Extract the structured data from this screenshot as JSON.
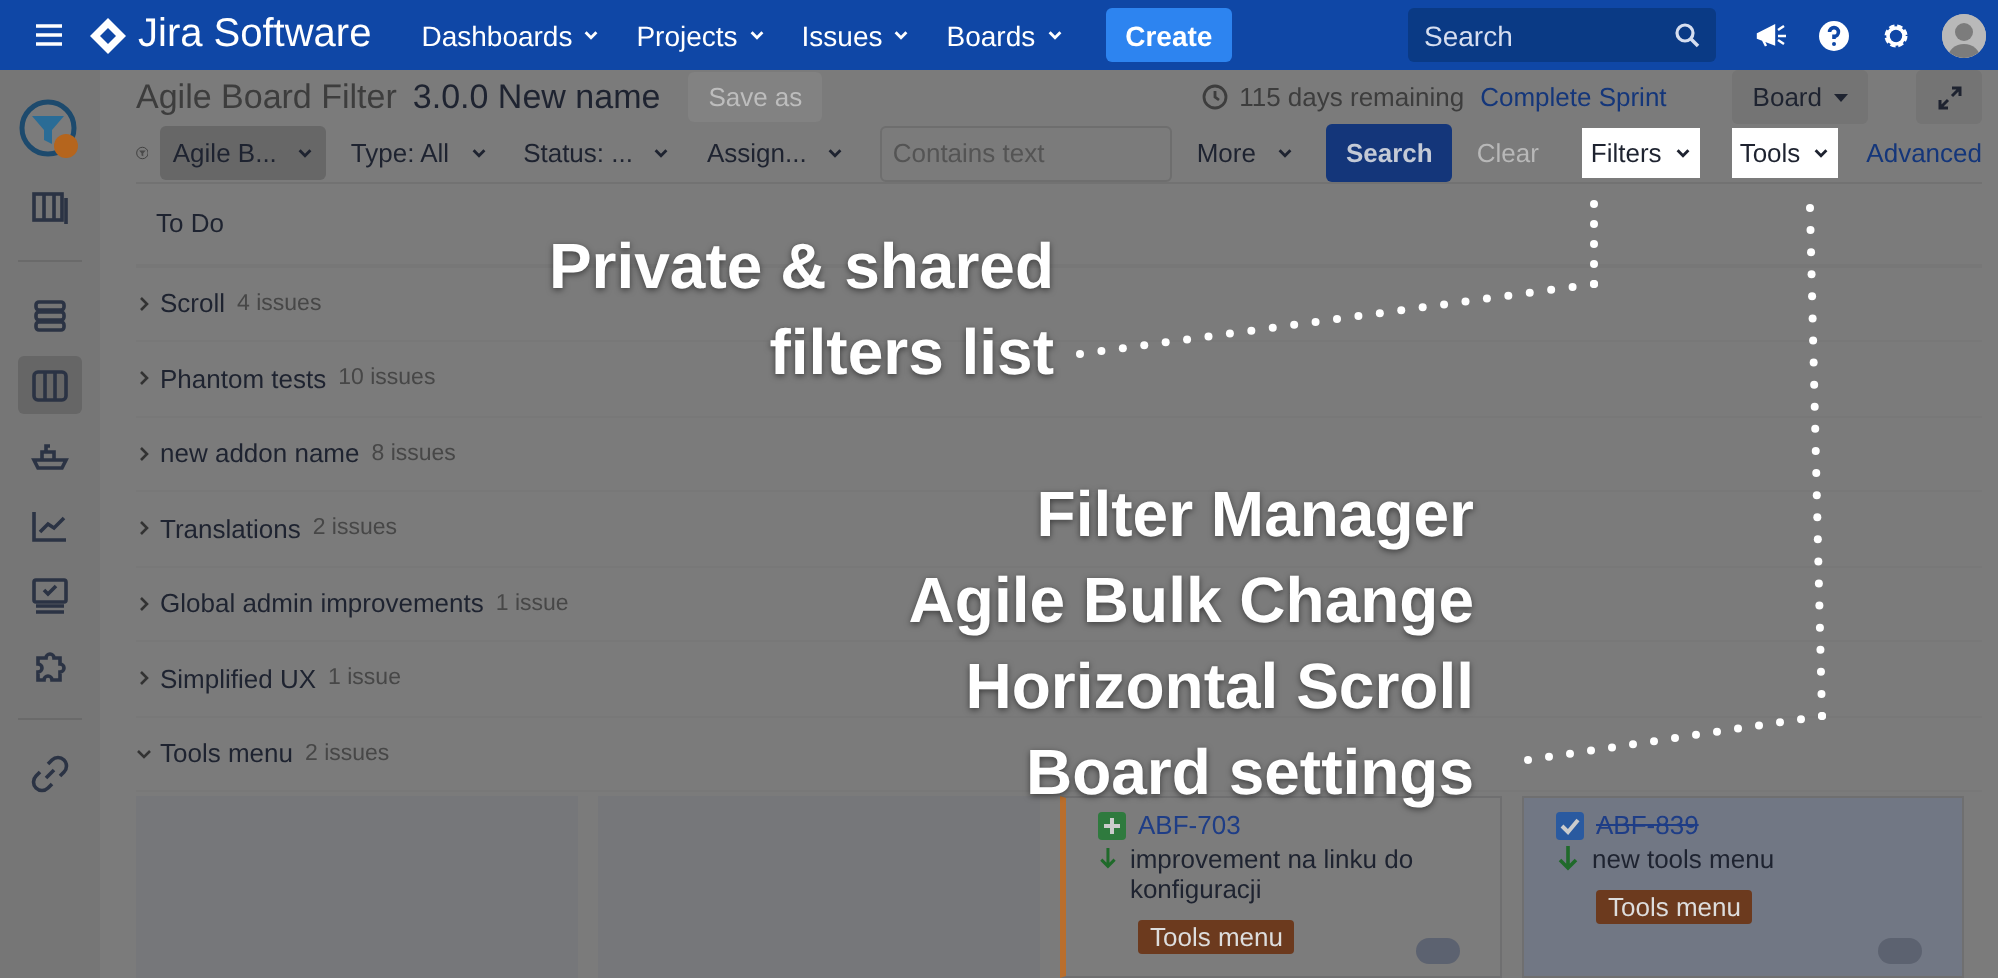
{
  "nav": {
    "brand": "Jira Software",
    "menus": [
      {
        "label": "Dashboards"
      },
      {
        "label": "Projects"
      },
      {
        "label": "Issues"
      },
      {
        "label": "Boards"
      }
    ],
    "create": "Create",
    "search": {
      "placeholder": "Search"
    }
  },
  "sidebar": {
    "groups": [
      {
        "items": [
          {
            "kind": "project",
            "selected": false
          },
          {
            "kind": "backlog",
            "selected": false
          }
        ]
      },
      {
        "items": [
          {
            "kind": "stack",
            "selected": false
          },
          {
            "kind": "board",
            "selected": true
          },
          {
            "kind": "ship",
            "selected": false
          },
          {
            "kind": "chart",
            "selected": false
          },
          {
            "kind": "monitor",
            "selected": false
          },
          {
            "kind": "puzzle",
            "selected": false
          }
        ]
      },
      {
        "items": [
          {
            "kind": "link",
            "selected": false
          }
        ]
      }
    ]
  },
  "header": {
    "title": "Agile Board Filter",
    "board_name": "3.0.0 New name",
    "save_as": {
      "label": "Save as",
      "disabled": true
    },
    "remaining": "115 days remaining",
    "complete_sprint": "Complete Sprint",
    "board_button": "Board"
  },
  "filter_bar": {
    "dropdowns": [
      {
        "label": "Agile B...",
        "selected": true
      },
      {
        "label": "Type: All",
        "selected": false
      },
      {
        "label": "Status: ...",
        "selected": false
      },
      {
        "label": "Assign...",
        "selected": false
      }
    ],
    "text_search": {
      "placeholder": "Contains text"
    },
    "more": "More",
    "search": "Search",
    "clear": {
      "label": "Clear",
      "disabled": true
    },
    "menus": [
      {
        "label": "Filters",
        "highlighted": true
      },
      {
        "label": "Tools",
        "highlighted": true
      }
    ],
    "advanced": "Advanced"
  },
  "column_header": "To Do",
  "swimlanes": [
    {
      "name": "Scroll",
      "count": "4 issues",
      "expanded": false
    },
    {
      "name": "Phantom tests",
      "count": "10 issues",
      "expanded": false
    },
    {
      "name": "new addon name",
      "count": "8 issues",
      "expanded": false
    },
    {
      "name": "Translations",
      "count": "2 issues",
      "expanded": false
    },
    {
      "name": "Global admin improvements",
      "count": "1 issue",
      "expanded": false
    },
    {
      "name": "Simplified UX",
      "count": "1 issue",
      "expanded": false
    },
    {
      "name": "Tools menu",
      "count": "2 issues",
      "expanded": true
    }
  ],
  "cards": [
    {
      "kind": "improvement",
      "key": "ABF-703",
      "done": false,
      "summary": "improvement na linku do konfiguracji",
      "label": "Tools menu"
    },
    {
      "kind": "task",
      "key": "ABF-839",
      "done": true,
      "summary": "new tools menu",
      "label": "Tools menu"
    }
  ],
  "annotations": [
    {
      "lines": [
        "Private & shared",
        "filters list"
      ]
    },
    {
      "lines": [
        "Filter Manager",
        "Agile Bulk Change",
        "Horizontal Scroll",
        "Board settings"
      ]
    }
  ]
}
